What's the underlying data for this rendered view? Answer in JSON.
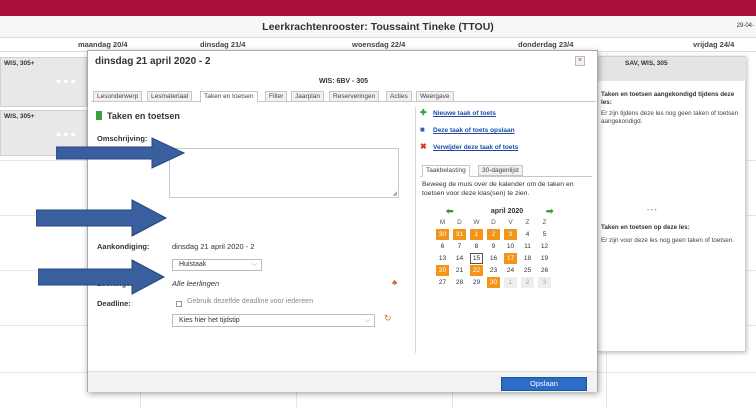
{
  "header": {
    "title": "Leerkrachtenrooster: Toussaint Tineke (TTOU)",
    "date_short": "29-04-"
  },
  "days": [
    "maandag 20/4",
    "dinsdag 21/4",
    "woensdag 22/4",
    "donderdag 23/4",
    "vrijdag 24/4"
  ],
  "background_cells": {
    "cell1_label": "WIS, 305+",
    "cell2_label": "WIS, 305+",
    "cell3_label": "SAV, WIS, 305",
    "dots": "●●●"
  },
  "right_panel": {
    "during_title": "Taken en toetsen aangekondigd tijdens deze les:",
    "during_text": "Er zijn tijdens deze les nog geen taken of toetsen aangekondigd.",
    "divider": "• • •",
    "on_title": "Taken en toetsen op deze les:",
    "on_text": "Er zijn voor deze les nog geen taken of toetsen."
  },
  "modal": {
    "title": "dinsdag 21 april 2020 - 2",
    "close_symbol": "×",
    "subtitle": "WIS: 6BV - 305",
    "tabs": [
      "Lesonderwerp",
      "Lesmateriaal",
      "Taken en toetsen",
      "Filter",
      "Jaarplan",
      "Reserveringen",
      "Acties",
      "Weergave"
    ],
    "active_tab": "Taken en toetsen",
    "section_title": "Taken en toetsen",
    "fields": {
      "description_label": "Omschrijving:",
      "description_value": "",
      "announcement_label": "Aankondiging:",
      "announcement_value": "dinsdag 21 april 2020 - 2",
      "type_value": "Huistaak",
      "students_label": "Leerlingen:",
      "students_value": "Alle leerlingen",
      "deadline_label": "Deadline:",
      "same_deadline_label": "Gebruik dezelfde deadline voor iedereen",
      "same_deadline_checked": false,
      "time_value": "Kies hier het tijdstip"
    },
    "actions": {
      "new": "Nieuwe taak of toets",
      "save": "Deze taak of toets opslaan",
      "delete": "Verwijder deze taak of toets"
    },
    "load_tabs": [
      "Taakbelasting",
      "30-dagenlijst"
    ],
    "load_text": "Beweeg de muis over de kalender om de taken en toetsen voor deze klas(sen) te zien.",
    "calendar": {
      "month": "april 2020",
      "weekdays": [
        "M",
        "D",
        "W",
        "D",
        "V",
        "Z",
        "Z"
      ],
      "weeks": [
        [
          "30",
          "31",
          "1",
          "2",
          "3",
          "4",
          "5"
        ],
        [
          "6",
          "7",
          "8",
          "9",
          "10",
          "11",
          "12"
        ],
        [
          "13",
          "14",
          "15",
          "16",
          "17",
          "18",
          "19"
        ],
        [
          "20",
          "21",
          "22",
          "23",
          "24",
          "25",
          "26"
        ],
        [
          "27",
          "28",
          "29",
          "30",
          "1",
          "2",
          "3"
        ]
      ],
      "marked_days": [
        "30",
        "31",
        "1",
        "2",
        "3",
        "17",
        "20",
        "22"
      ],
      "today": "15",
      "mark_color": "#f29519"
    },
    "save_button": "Opslaan"
  },
  "colors": {
    "brand_bar": "#ad0f3c",
    "link": "#1a4ea6",
    "button": "#2b6cc4",
    "arrow": "#3a5f9e"
  }
}
